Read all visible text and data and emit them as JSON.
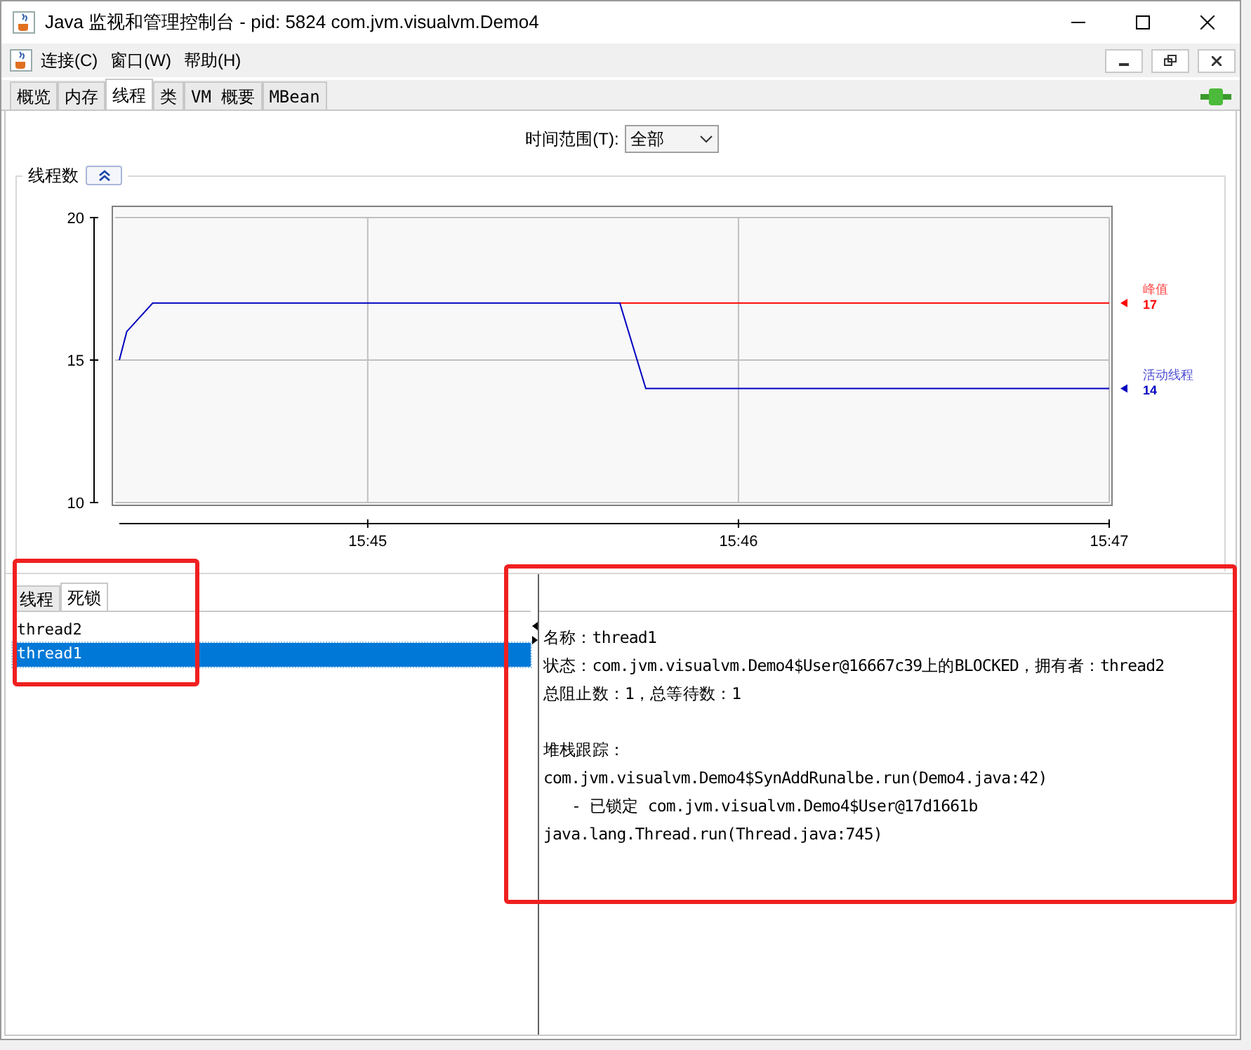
{
  "window": {
    "title": "Java 监视和管理控制台 - pid: 5824 com.jvm.visualvm.Demo4"
  },
  "menu": [
    "连接(C)",
    "窗口(W)",
    "帮助(H)"
  ],
  "tabs": [
    {
      "label": "概览",
      "selected": false
    },
    {
      "label": "内存",
      "selected": false
    },
    {
      "label": "线程",
      "selected": true
    },
    {
      "label": "类",
      "selected": false
    },
    {
      "label": "VM 概要",
      "selected": false
    },
    {
      "label": "MBean",
      "selected": false
    }
  ],
  "time_range": {
    "label": "时间范围(T):",
    "value": "全部"
  },
  "chart_panel": {
    "title": "线程数",
    "expanded": true,
    "legend_readings": [
      "17",
      "14"
    ],
    "chart_data": {
      "type": "line",
      "x": [
        944.33,
        944.35,
        944.42,
        945.68,
        945.75,
        947.0
      ],
      "xlim": [
        944.33,
        947.0
      ],
      "ylim": [
        10,
        20
      ],
      "xticks": [
        {
          "value": 945,
          "label": "15:45"
        },
        {
          "value": 946,
          "label": "15:46"
        },
        {
          "value": 947,
          "label": "15:47"
        }
      ],
      "yticks": [
        10,
        15,
        20
      ],
      "grid": true,
      "series": [
        {
          "name": "峰值",
          "color": "#ff0000",
          "values": [
            null,
            null,
            null,
            17,
            17,
            17
          ]
        },
        {
          "name": "活动线程",
          "color": "#0000c0",
          "values": [
            15,
            16,
            17,
            17,
            14,
            14
          ]
        }
      ]
    }
  },
  "sub_tabs": [
    {
      "label": "线程",
      "selected": false
    },
    {
      "label": "死锁",
      "selected": true
    }
  ],
  "threads": [
    {
      "name": "thread2",
      "selected": false
    },
    {
      "name": "thread1",
      "selected": true
    }
  ],
  "details": {
    "info": [
      "名称：thread1",
      "状态：com.jvm.visualvm.Demo4$User@16667c39上的BLOCKED，拥有者：thread2",
      "总阻止数：1，总等待数：1"
    ],
    "stack_title": "堆栈跟踪：",
    "frames": [
      {
        "kind": "frame",
        "text": "com.jvm.visualvm.Demo4$SynAddRunalbe.run(Demo4.java:42)"
      },
      {
        "kind": "lock",
        "text": "- 已锁定 com.jvm.visualvm.Demo4$User@17d1661b"
      },
      {
        "kind": "frame",
        "text": "java.lang.Thread.run(Thread.java:745)"
      }
    ]
  }
}
